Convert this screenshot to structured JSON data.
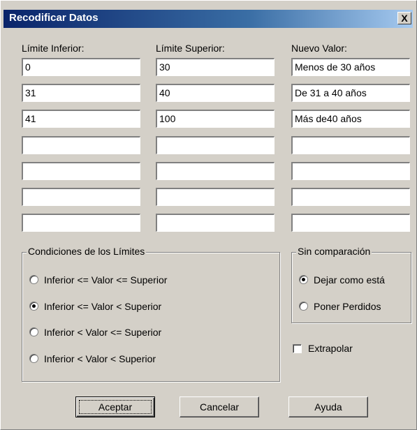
{
  "dialog": {
    "title": "Recodificar Datos",
    "close_label": "X"
  },
  "columns": {
    "lower_label": "Límite Inferior:",
    "upper_label": "Límite Superior:",
    "new_label": "Nuevo Valor:"
  },
  "rows": [
    {
      "lower": "0",
      "upper": "30",
      "new": "Menos de 30 años"
    },
    {
      "lower": "31",
      "upper": "40",
      "new": "De 31 a 40 años"
    },
    {
      "lower": "41",
      "upper": "100",
      "new": "Más de40 años"
    },
    {
      "lower": "",
      "upper": "",
      "new": ""
    },
    {
      "lower": "",
      "upper": "",
      "new": ""
    },
    {
      "lower": "",
      "upper": "",
      "new": ""
    },
    {
      "lower": "",
      "upper": "",
      "new": ""
    }
  ],
  "conditions": {
    "title": "Condiciones de los Límites",
    "options": [
      {
        "label": "Inferior <= Valor <= Superior",
        "selected": false
      },
      {
        "label": "Inferior <= Valor < Superior",
        "selected": true
      },
      {
        "label": "Inferior < Valor <= Superior",
        "selected": false
      },
      {
        "label": "Inferior < Valor < Superior",
        "selected": false
      }
    ]
  },
  "no_match": {
    "title": "Sin comparación",
    "options": [
      {
        "label": "Dejar como está",
        "selected": true
      },
      {
        "label": "Poner Perdidos",
        "selected": false
      }
    ]
  },
  "extrapolate": {
    "label": "Extrapolar",
    "checked": false
  },
  "buttons": {
    "accept": "Aceptar",
    "cancel": "Cancelar",
    "help": "Ayuda"
  }
}
